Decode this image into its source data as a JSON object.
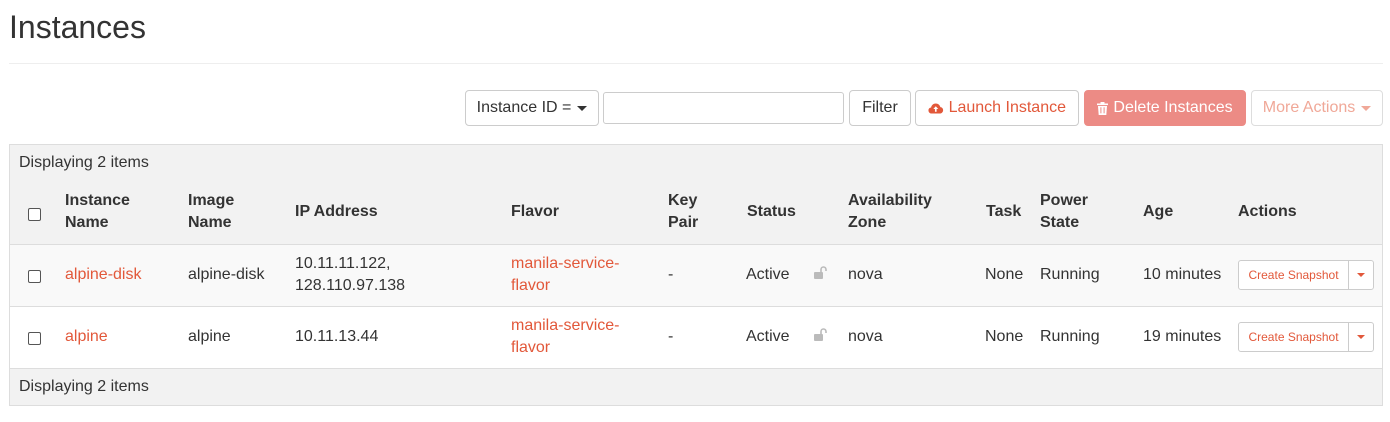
{
  "page": {
    "title": "Instances"
  },
  "toolbar": {
    "filter_field_label": "Instance ID =",
    "filter_input_value": "",
    "filter_label": "Filter",
    "launch_label": "Launch Instance",
    "delete_label": "Delete Instances",
    "more_label": "More Actions"
  },
  "table": {
    "count_top": "Displaying 2 items",
    "count_bottom": "Displaying 2 items",
    "headers": {
      "instance_name": [
        "Instance",
        "Name"
      ],
      "image_name": [
        "Image",
        "Name"
      ],
      "ip_address": "IP Address",
      "flavor": "Flavor",
      "key_pair": [
        "Key",
        "Pair"
      ],
      "status": "Status",
      "availability_zone": [
        "Availability",
        "Zone"
      ],
      "task": "Task",
      "power_state": [
        "Power",
        "State"
      ],
      "age": "Age",
      "actions": "Actions"
    },
    "rows": [
      {
        "name": "alpine-disk",
        "image": "alpine-disk",
        "ip": [
          "10.11.11.122,",
          "128.110.97.138"
        ],
        "flavor": [
          "manila-service-",
          "flavor"
        ],
        "key_pair": "-",
        "status": "Active",
        "zone": "nova",
        "task": "None",
        "power": "Running",
        "age": "10 minutes",
        "action": "Create Snapshot"
      },
      {
        "name": "alpine",
        "image": "alpine",
        "ip": [
          "10.11.13.44"
        ],
        "flavor": [
          "manila-service-",
          "flavor"
        ],
        "key_pair": "-",
        "status": "Active",
        "zone": "nova",
        "task": "None",
        "power": "Running",
        "age": "19 minutes",
        "action": "Create Snapshot"
      }
    ]
  },
  "colors": {
    "accent": "#e2583a",
    "danger": "#ec8b85",
    "table_bg": "#f2f2f2",
    "border": "#dddddd"
  }
}
